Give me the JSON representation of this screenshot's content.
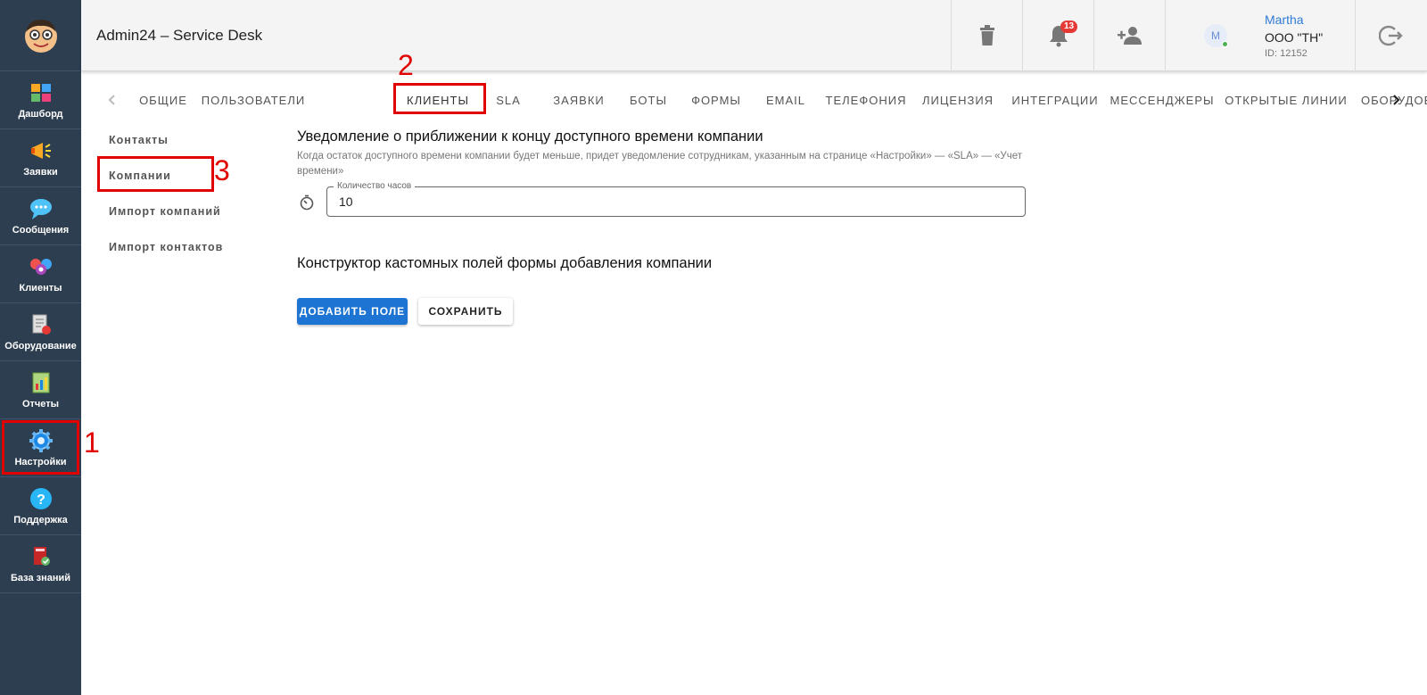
{
  "app": {
    "title": "Admin24 – Service Desk"
  },
  "sidebar": {
    "items": [
      {
        "label": "Дашборд",
        "icon": "dashboard-icon"
      },
      {
        "label": "Заявки",
        "icon": "megaphone-icon"
      },
      {
        "label": "Сообщения",
        "icon": "chat-icon"
      },
      {
        "label": "Клиенты",
        "icon": "clients-icon"
      },
      {
        "label": "Оборудование",
        "icon": "equipment-icon"
      },
      {
        "label": "Отчеты",
        "icon": "reports-icon"
      },
      {
        "label": "Настройки",
        "icon": "gear-icon"
      },
      {
        "label": "Поддержка",
        "icon": "help-icon"
      },
      {
        "label": "База знаний",
        "icon": "knowledge-base-icon"
      }
    ]
  },
  "topbar": {
    "notifications_count": "13",
    "user": {
      "avatar_letter": "M",
      "name": "Martha",
      "company": "ООО \"ТН\"",
      "id": "ID: 12152"
    }
  },
  "tabs": [
    "Общие",
    "Пользователи",
    "Клиенты",
    "SLA",
    "Заявки",
    "Боты",
    "Формы",
    "Email",
    "Телефония",
    "Лицензия",
    "Интеграции",
    "Мессенджеры",
    "Открытые линии",
    "Оборудование"
  ],
  "subnav": [
    "Контакты",
    "Компании",
    "Импорт компаний",
    "Импорт контактов"
  ],
  "main": {
    "notify_title": "Уведомление о приближении к концу доступного времени компании",
    "notify_desc": "Когда остаток доступного времени компании будет меньше, придет уведомление сотрудникам, указанным на странице «Настройки» — «SLA» — «Учет времени»",
    "hours_label": "Количество часов",
    "hours_value": "10",
    "constructor_title": "Конструктор кастомных полей формы добавления компании",
    "add_field_label": "ДОБАВИТЬ ПОЛЕ",
    "save_label": "СОХРАНИТЬ"
  },
  "annotations": {
    "step1": "1",
    "step2": "2",
    "step3": "3"
  },
  "colors": {
    "sidebar": "#2d3e50",
    "accent": "#1e74d2",
    "highlight": "#e00000",
    "link": "#2f7bd6"
  }
}
